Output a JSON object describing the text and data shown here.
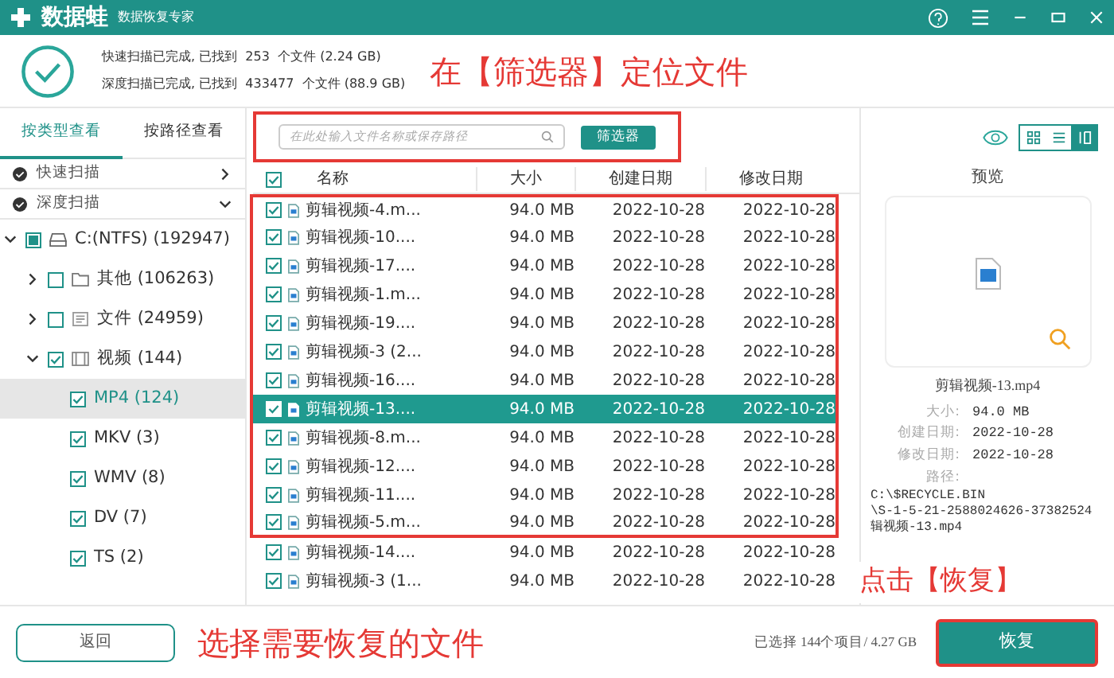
{
  "app": {
    "name": "数据蛙",
    "subtitle": "数据恢复专家"
  },
  "scan_summary": [
    "快速扫描已完成, 已找到  253  个文件 (2.24 GB)",
    "深度扫描已完成, 已找到  433477  个文件 (88.9 GB)"
  ],
  "top_annotation": "在【筛选器】定位文件",
  "view_tabs": [
    {
      "label": "按类型查看",
      "selected": true
    },
    {
      "label": "按路径查看",
      "selected": false
    }
  ],
  "scan_groups": [
    {
      "label": "快速扫描",
      "expanded": false
    },
    {
      "label": "深度扫描",
      "expanded": true
    }
  ],
  "tree": [
    {
      "label": "C:(NTFS) (192947)",
      "kind": "drive",
      "checked": false,
      "partial": true,
      "expanded": true,
      "selected": false,
      "children": [
        {
          "label": "其他 (106263)",
          "kind": "folder",
          "checked": false,
          "expanded": false,
          "selected": false
        },
        {
          "label": "文件 (24959)",
          "kind": "document",
          "checked": false,
          "expanded": false,
          "selected": false
        },
        {
          "label": "视频 (144)",
          "kind": "video",
          "checked": true,
          "expanded": true,
          "selected": false,
          "children": [
            {
              "label": "MP4 (124)",
              "checked": true,
              "selected": true
            },
            {
              "label": "MKV (3)",
              "checked": true,
              "selected": false
            },
            {
              "label": "WMV (8)",
              "checked": true,
              "selected": false
            },
            {
              "label": "DV (7)",
              "checked": true,
              "selected": false
            },
            {
              "label": "TS (2)",
              "checked": true,
              "selected": false
            }
          ]
        }
      ]
    }
  ],
  "search": {
    "placeholder": "在此处输入文件名称或保存路径"
  },
  "filter_button": "筛选器",
  "view_modes": [
    {
      "kind": "grid",
      "selected": false
    },
    {
      "kind": "list",
      "selected": false
    },
    {
      "kind": "detail",
      "selected": true
    }
  ],
  "table": {
    "all_checked": true,
    "columns": [
      "名称",
      "大小",
      "创建日期",
      "修改日期"
    ],
    "rows": [
      {
        "name": "剪辑视频-4.m...",
        "size": "94.0 MB",
        "created": "2022-10-28",
        "modified": "2022-10-28",
        "checked": true,
        "selected": false,
        "highlighted": true
      },
      {
        "name": "剪辑视频-10....",
        "size": "94.0 MB",
        "created": "2022-10-28",
        "modified": "2022-10-28",
        "checked": true,
        "selected": false,
        "highlighted": true
      },
      {
        "name": "剪辑视频-17....",
        "size": "94.0 MB",
        "created": "2022-10-28",
        "modified": "2022-10-28",
        "checked": true,
        "selected": false,
        "highlighted": true
      },
      {
        "name": "剪辑视频-1.m...",
        "size": "94.0 MB",
        "created": "2022-10-28",
        "modified": "2022-10-28",
        "checked": true,
        "selected": false,
        "highlighted": true
      },
      {
        "name": "剪辑视频-19....",
        "size": "94.0 MB",
        "created": "2022-10-28",
        "modified": "2022-10-28",
        "checked": true,
        "selected": false,
        "highlighted": true
      },
      {
        "name": "剪辑视频-3 (2...",
        "size": "94.0 MB",
        "created": "2022-10-28",
        "modified": "2022-10-28",
        "checked": true,
        "selected": false,
        "highlighted": true
      },
      {
        "name": "剪辑视频-16....",
        "size": "94.0 MB",
        "created": "2022-10-28",
        "modified": "2022-10-28",
        "checked": true,
        "selected": false,
        "highlighted": true
      },
      {
        "name": "剪辑视频-13....",
        "size": "94.0 MB",
        "created": "2022-10-28",
        "modified": "2022-10-28",
        "checked": true,
        "selected": true,
        "highlighted": true
      },
      {
        "name": "剪辑视频-8.m...",
        "size": "94.0 MB",
        "created": "2022-10-28",
        "modified": "2022-10-28",
        "checked": true,
        "selected": false,
        "highlighted": true
      },
      {
        "name": "剪辑视频-12....",
        "size": "94.0 MB",
        "created": "2022-10-28",
        "modified": "2022-10-28",
        "checked": true,
        "selected": false,
        "highlighted": true
      },
      {
        "name": "剪辑视频-11....",
        "size": "94.0 MB",
        "created": "2022-10-28",
        "modified": "2022-10-28",
        "checked": true,
        "selected": false,
        "highlighted": true
      },
      {
        "name": "剪辑视频-5.m...",
        "size": "94.0 MB",
        "created": "2022-10-28",
        "modified": "2022-10-28",
        "checked": true,
        "selected": false,
        "highlighted": true
      },
      {
        "name": "剪辑视频-14....",
        "size": "94.0 MB",
        "created": "2022-10-28",
        "modified": "2022-10-28",
        "checked": true,
        "selected": false,
        "highlighted": false
      },
      {
        "name": "剪辑视频-3 (1...",
        "size": "94.0 MB",
        "created": "2022-10-28",
        "modified": "2022-10-28",
        "checked": true,
        "selected": false,
        "highlighted": false
      }
    ]
  },
  "preview": {
    "title": "预览",
    "file_name": "剪辑视频-13.mp4",
    "details": [
      {
        "label": "大小:",
        "value": "94.0 MB"
      },
      {
        "label": "创建日期:",
        "value": "2022-10-28"
      },
      {
        "label": "修改日期:",
        "value": "2022-10-28"
      },
      {
        "label": "路径:"
      }
    ],
    "path_lines": [
      "C:\\$RECYCLE.BIN",
      "\\S-1-5-21-2588024626-37382524",
      "辑视频-13.mp4"
    ]
  },
  "recover_annotation": "点击【恢复】",
  "bottom": {
    "back_button": "返回",
    "annotation": "选择需要恢复的文件",
    "selection_summary": "已选择 144个项目/ 4.27 GB",
    "recover_button": "恢复"
  }
}
